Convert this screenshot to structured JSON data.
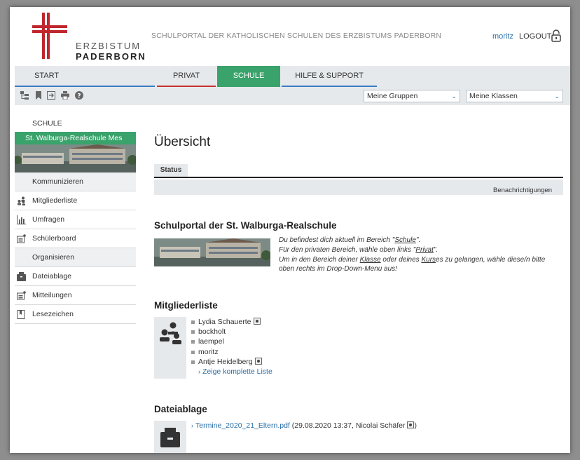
{
  "header": {
    "logo_line1": "ERZBISTUM",
    "logo_line2": "PADERBORN",
    "portal_title": "SCHULPORTAL DER KATHOLISCHEN SCHULEN DES ERZBISTUMS PADERBORN",
    "username": "moritz",
    "logout_label": "LOGOUT"
  },
  "nav": {
    "start": "START",
    "privat": "PRIVAT",
    "schule": "SCHULE",
    "hilfe": "HILFE & SUPPORT"
  },
  "toolbar": {
    "groups_select": "Meine Gruppen",
    "classes_select": "Meine Klassen"
  },
  "sidebar": {
    "title": "SCHULE",
    "school_name": "St. Walburga-Realschule Mes",
    "section_communicate": "Kommunizieren",
    "items_communicate": [
      {
        "label": "Mitgliederliste",
        "icon": "members-icon"
      },
      {
        "label": "Umfragen",
        "icon": "chart-icon"
      },
      {
        "label": "Schülerboard",
        "icon": "board-icon"
      }
    ],
    "section_organize": "Organisieren",
    "items_organize": [
      {
        "label": "Dateiablage",
        "icon": "file-storage-icon"
      },
      {
        "label": "Mitteilungen",
        "icon": "messages-icon"
      },
      {
        "label": "Lesezeichen",
        "icon": "bookmark-icon"
      }
    ]
  },
  "main": {
    "page_title": "Übersicht",
    "tab_status": "Status",
    "notifications_link": "Benachrichtigungen",
    "portal_heading": "Schulportal der St. Walburga-Realschule",
    "intro": {
      "line1_pre": "Du befindest dich aktuell im Bereich \"",
      "line1_link": "Schule",
      "line1_post": "\".",
      "line2_pre": "Für den privaten Bereich, wähle oben links \"",
      "line2_link": "Privat",
      "line2_post": "\".",
      "line3_pre": "Um in den Bereich deiner ",
      "line3_link1": "Klasse",
      "line3_mid": " oder deines ",
      "line3_link2": "Kurs",
      "line3_post": "es zu gelangen, wähle diese/n bitte",
      "line4": "oben rechts im Drop-Down-Menu aus!"
    },
    "members_heading": "Mitgliederliste",
    "members": [
      "Lydia Schauerte",
      "bockholt",
      "laempel",
      "moritz",
      "Antje Heidelberg"
    ],
    "members_show_all": "Zeige komplette Liste",
    "files_heading": "Dateiablage",
    "file_name": "Termine_2020_21_Eltern.pdf",
    "file_meta": "(29.08.2020 13:37, Nicolai Schäfer",
    "file_meta_close": ")"
  },
  "colors": {
    "accent_green": "#3aa36b",
    "nav_blue": "#3a7cc2",
    "nav_red": "#c9302c",
    "link_blue": "#2a6fa8",
    "logo_red": "#c0262d"
  }
}
